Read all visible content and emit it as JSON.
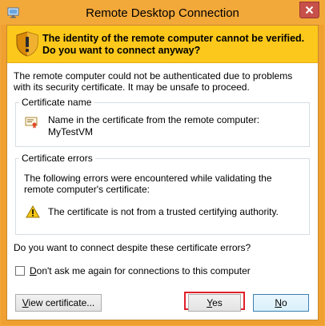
{
  "window": {
    "title": "Remote Desktop Connection"
  },
  "banner": {
    "text": "The identity of the remote computer cannot be verified. Do you want to connect anyway?"
  },
  "intro": "The remote computer could not be authenticated due to problems with its security certificate. It may be unsafe to proceed.",
  "certificate_name": {
    "legend": "Certificate name",
    "line1": "Name in the certificate from the remote computer:",
    "line2": "MyTestVM"
  },
  "certificate_errors": {
    "legend": "Certificate errors",
    "description": "The following errors were encountered while validating the remote computer's certificate:",
    "items": [
      {
        "icon": "warning-icon",
        "text": "The certificate is not from a trusted certifying authority."
      }
    ]
  },
  "question": "Do you want to connect despite these certificate errors?",
  "dont_ask": {
    "label_first": "D",
    "label_rest": "on't ask me again for connections to this computer",
    "checked": false
  },
  "buttons": {
    "view_first": "V",
    "view_rest": "iew certificate...",
    "yes_first": "Y",
    "yes_rest": "es",
    "no_first": "N",
    "no_rest": "o"
  },
  "colors": {
    "title_bar": "#f3a83a",
    "banner": "#fcc81b",
    "close_button": "#c7504a",
    "highlight": "#e0202a"
  }
}
